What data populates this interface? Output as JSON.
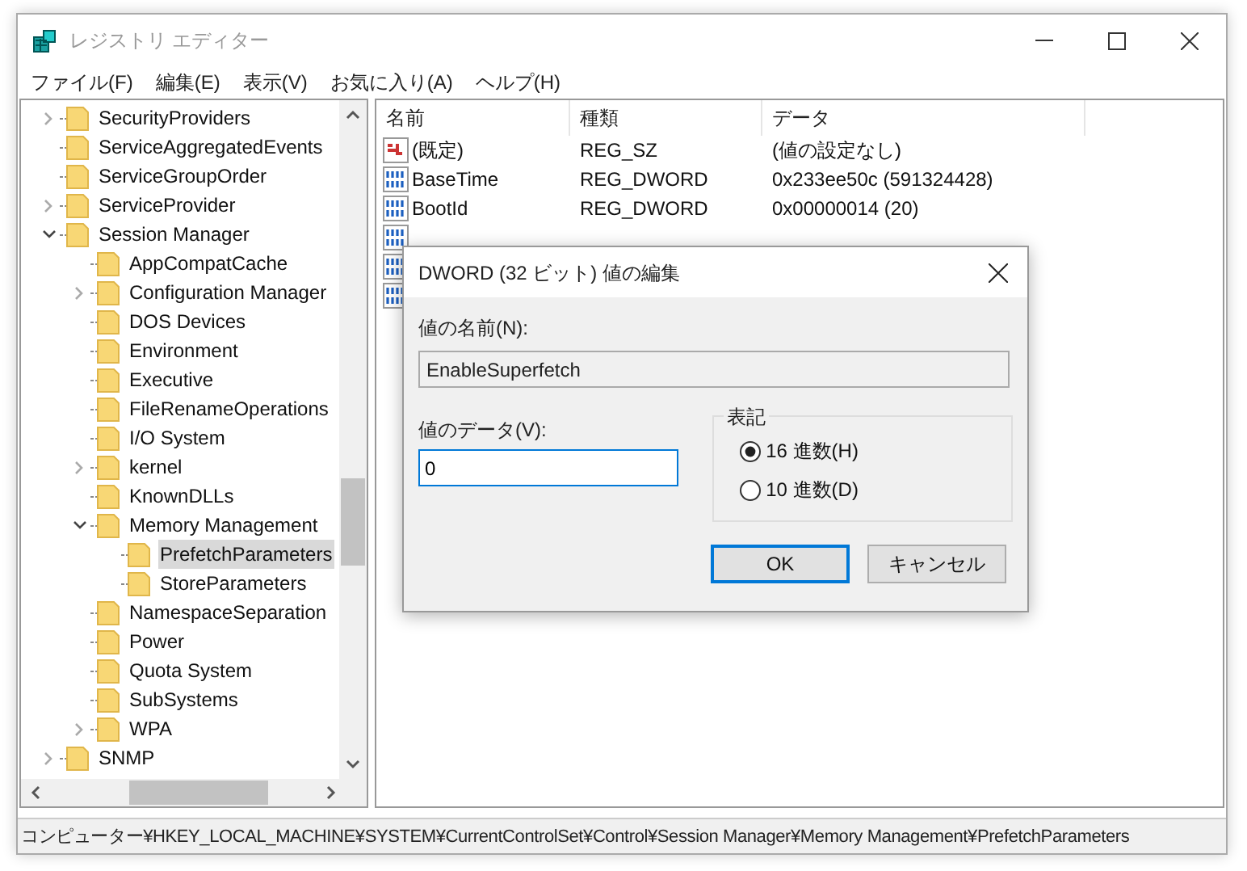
{
  "window": {
    "title": "レジストリ エディター"
  },
  "menu": [
    "ファイル(F)",
    "編集(E)",
    "表示(V)",
    "お気に入り(A)",
    "ヘルプ(H)"
  ],
  "tree": [
    {
      "label": "SecurityProviders",
      "expanded": false,
      "selected": false
    },
    {
      "label": "ServiceAggregatedEvents",
      "selected": false
    },
    {
      "label": "ServiceGroupOrder",
      "selected": false
    },
    {
      "label": "ServiceProvider",
      "expanded": false,
      "selected": false
    },
    {
      "label": "Session Manager",
      "expanded": true,
      "selected": false,
      "children": [
        {
          "label": "AppCompatCache",
          "selected": false
        },
        {
          "label": "Configuration Manager",
          "expanded": false,
          "selected": false
        },
        {
          "label": "DOS Devices",
          "selected": false
        },
        {
          "label": "Environment",
          "selected": false
        },
        {
          "label": "Executive",
          "selected": false
        },
        {
          "label": "FileRenameOperations",
          "selected": false
        },
        {
          "label": "I/O System",
          "selected": false
        },
        {
          "label": "kernel",
          "expanded": false,
          "selected": false
        },
        {
          "label": "KnownDLLs",
          "selected": false
        },
        {
          "label": "Memory Management",
          "expanded": true,
          "selected": false,
          "children": [
            {
              "label": "PrefetchParameters",
              "selected": true
            },
            {
              "label": "StoreParameters",
              "selected": false
            }
          ]
        },
        {
          "label": "NamespaceSeparation",
          "selected": false
        },
        {
          "label": "Power",
          "selected": false
        },
        {
          "label": "Quota System",
          "selected": false
        },
        {
          "label": "SubSystems",
          "selected": false
        },
        {
          "label": "WPA",
          "expanded": false,
          "selected": false
        }
      ]
    },
    {
      "label": "SNMP",
      "expanded": false,
      "selected": false
    }
  ],
  "values": {
    "columns": [
      "名前",
      "種類",
      "データ"
    ],
    "rows": [
      {
        "kind": "string",
        "name": "(既定)",
        "type": "REG_SZ",
        "data": "(値の設定なし)"
      },
      {
        "kind": "binary",
        "name": "BaseTime",
        "type": "REG_DWORD",
        "data": "0x233ee50c (591324428)"
      },
      {
        "kind": "binary",
        "name": "BootId",
        "type": "REG_DWORD",
        "data": "0x00000014 (20)"
      },
      {
        "kind": "binary"
      },
      {
        "kind": "binary"
      },
      {
        "kind": "binary"
      }
    ]
  },
  "dialog": {
    "title": "DWORD (32 ビット) 値の編集",
    "name_label": "値の名前(N):",
    "name_value": "EnableSuperfetch",
    "data_label": "値のデータ(V):",
    "data_value": "0",
    "base_label": "表記",
    "bases": [
      {
        "label": "16 進数(H)",
        "selected": true
      },
      {
        "label": "10 進数(D)",
        "selected": false
      }
    ],
    "buttons": [
      "OK",
      "キャンセル"
    ]
  },
  "status_bar": "コンピューター¥HKEY_LOCAL_MACHINE¥SYSTEM¥CurrentControlSet¥Control¥Session Manager¥Memory Management¥PrefetchParameters"
}
